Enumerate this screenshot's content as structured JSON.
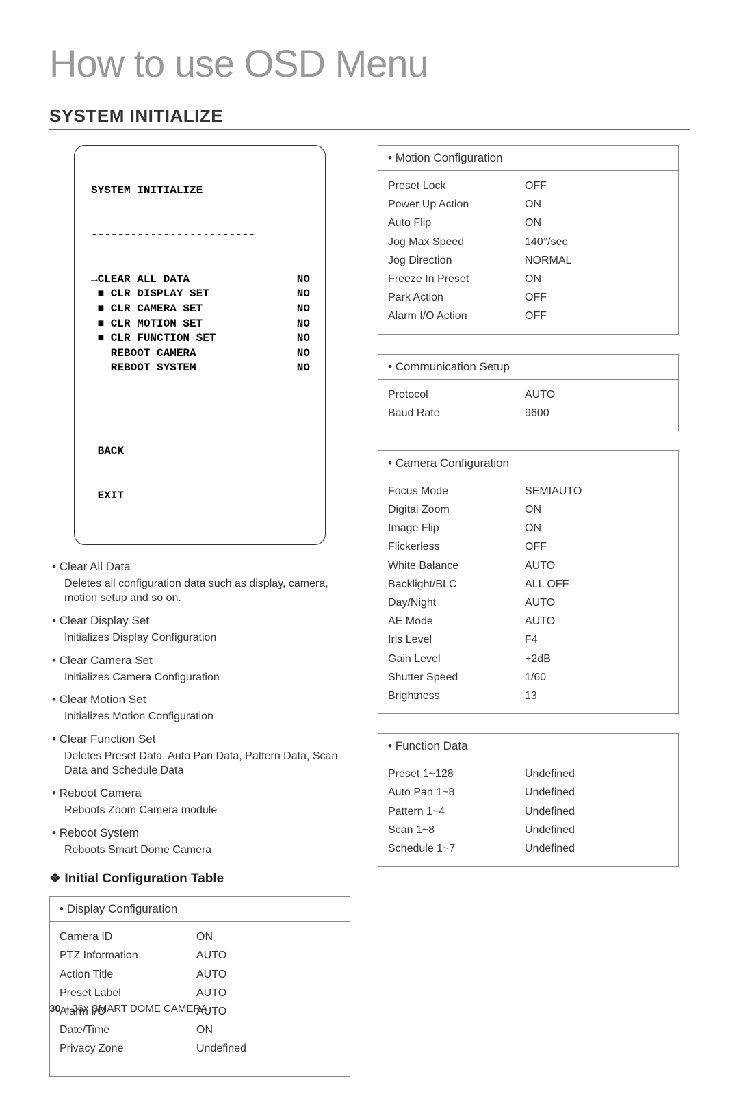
{
  "title": "How to use OSD Menu",
  "section": "SYSTEM INITIALIZE",
  "osd_menu": {
    "heading": "SYSTEM INITIALIZE",
    "divider": "-------------------------",
    "items": [
      {
        "left": "→CLEAR ALL DATA",
        "right": "NO"
      },
      {
        "left": " ■ CLR DISPLAY SET",
        "right": "NO"
      },
      {
        "left": " ■ CLR CAMERA SET",
        "right": "NO"
      },
      {
        "left": " ■ CLR MOTION SET",
        "right": "NO"
      },
      {
        "left": " ■ CLR FUNCTION SET",
        "right": "NO"
      },
      {
        "left": "   REBOOT CAMERA",
        "right": "NO"
      },
      {
        "left": "   REBOOT SYSTEM",
        "right": "NO"
      }
    ],
    "footer1": " BACK",
    "footer2": " EXIT"
  },
  "descriptions": [
    {
      "term": "Clear All Data",
      "body": "Deletes all configuration data such as display, camera, motion setup and so on."
    },
    {
      "term": "Clear Display Set",
      "body": "Initializes Display Configuration"
    },
    {
      "term": "Clear Camera Set",
      "body": "Initializes Camera Configuration"
    },
    {
      "term": "Clear Motion Set",
      "body": "Initializes Motion Configuration"
    },
    {
      "term": "Clear Function Set",
      "body": "Deletes Preset Data, Auto Pan Data, Pattern Data, Scan Data and Schedule Data"
    },
    {
      "term": "Reboot Camera",
      "body": "Reboots Zoom Camera module"
    },
    {
      "term": "Reboot System",
      "body": "Reboots Smart Dome Camera"
    }
  ],
  "subheading": "Initial Configuration Table",
  "cards": {
    "display": {
      "title": "Display Configuration",
      "rows": [
        {
          "k": "Camera ID",
          "v": "ON"
        },
        {
          "k": "PTZ Information",
          "v": "AUTO"
        },
        {
          "k": "Action Title",
          "v": "AUTO"
        },
        {
          "k": "Preset Label",
          "v": "AUTO"
        },
        {
          "k": "Alarm I/O",
          "v": "AUTO"
        },
        {
          "k": "Date/Time",
          "v": "ON"
        },
        {
          "k": "Privacy Zone",
          "v": "Undefined"
        }
      ]
    },
    "motion": {
      "title": "Motion Configuration",
      "rows": [
        {
          "k": "Preset Lock",
          "v": "OFF"
        },
        {
          "k": "Power Up Action",
          "v": "ON"
        },
        {
          "k": "Auto Flip",
          "v": "ON"
        },
        {
          "k": "Jog Max Speed",
          "v": "140°/sec"
        },
        {
          "k": "Jog Direction",
          "v": "NORMAL"
        },
        {
          "k": "Freeze In Preset",
          "v": "ON"
        },
        {
          "k": "Park Action",
          "v": "OFF"
        },
        {
          "k": "Alarm I/O Action",
          "v": "OFF"
        }
      ]
    },
    "comm": {
      "title": "Communication Setup",
      "rows": [
        {
          "k": "Protocol",
          "v": "AUTO"
        },
        {
          "k": "Baud Rate",
          "v": "9600"
        }
      ]
    },
    "camera": {
      "title": "Camera Configuration",
      "rows": [
        {
          "k": "Focus Mode",
          "v": "SEMIAUTO"
        },
        {
          "k": "Digital Zoom",
          "v": "ON"
        },
        {
          "k": "Image Flip",
          "v": "ON"
        },
        {
          "k": "Flickerless",
          "v": "OFF"
        },
        {
          "k": "White Balance",
          "v": "AUTO"
        },
        {
          "k": "Backlight/BLC",
          "v": "ALL OFF"
        },
        {
          "k": "Day/Night",
          "v": "AUTO"
        },
        {
          "k": "AE Mode",
          "v": "AUTO"
        },
        {
          "k": "Iris Level",
          "v": "F4"
        },
        {
          "k": "Gain Level",
          "v": "+2dB"
        },
        {
          "k": "Shutter Speed",
          "v": "1/60"
        },
        {
          "k": "Brightness",
          "v": "13"
        }
      ]
    },
    "func": {
      "title": "Function Data",
      "rows": [
        {
          "k": "Preset 1~128",
          "v": "Undefined"
        },
        {
          "k": "Auto Pan 1~8",
          "v": "Undefined"
        },
        {
          "k": "Pattern 1~4",
          "v": "Undefined"
        },
        {
          "k": "Scan 1~8",
          "v": "Undefined"
        },
        {
          "k": "Schedule 1~7",
          "v": "Undefined"
        }
      ]
    }
  },
  "footer": {
    "page": "30",
    "sep": " – ",
    "model": "36x SMART DOME CAMERA"
  }
}
